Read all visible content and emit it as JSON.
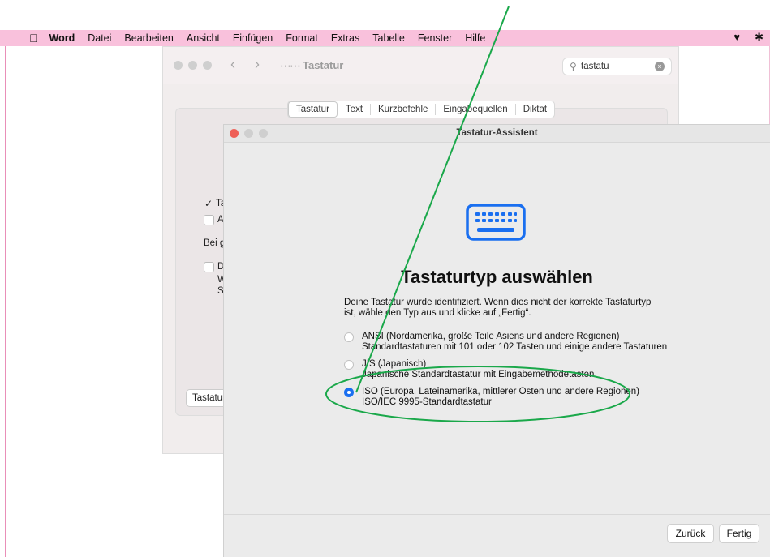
{
  "menubar": {
    "app": "Word",
    "items": [
      "Datei",
      "Bearbeiten",
      "Ansicht",
      "Einfügen",
      "Format",
      "Extras",
      "Tabelle",
      "Fenster",
      "Hilfe"
    ],
    "icons": [
      "apple-icon",
      "heart-icon",
      "bluetooth-icon"
    ]
  },
  "prefs": {
    "title": "Tastatur",
    "search_value": "tastatu",
    "tabs": [
      "Tastatur",
      "Text",
      "Kurzbefehle",
      "Eingabequellen",
      "Diktat"
    ],
    "selected_tab": "Tastatur",
    "partial_labels": [
      "Ta",
      "A",
      "Bei g",
      "D",
      "W",
      "S"
    ],
    "button_label": "Tastatur"
  },
  "assistant": {
    "title": "Tastatur-Assistent",
    "heading": "Tastaturtyp auswählen",
    "description": "Deine Tastatur wurde identifiziert. Wenn dies nicht der korrekte Tastaturtyp ist, wähle den Typ aus und klicke auf „Fertig“.",
    "options": [
      {
        "line1": "ANSI (Nordamerika, große Teile Asiens und andere Regionen)",
        "line2": "Standardtastaturen mit 101 oder 102 Tasten und einige andere Tastaturen",
        "selected": false
      },
      {
        "line1": "JIS (Japanisch)",
        "line2": "Japanische Standardtastatur mit Eingabemethodetasten",
        "selected": false
      },
      {
        "line1": "ISO (Europa, Lateinamerika, mittlerer Osten und andere Regionen)",
        "line2": "ISO/IEC 9995-Standardtastatur",
        "selected": true
      }
    ],
    "back_label": "Zurück",
    "done_label": "Fertig"
  },
  "colors": {
    "menubar": "#f9c1dc",
    "accent": "#1a6ff0",
    "annotation": "#1aa84a",
    "close_button": "#ee5f57"
  }
}
